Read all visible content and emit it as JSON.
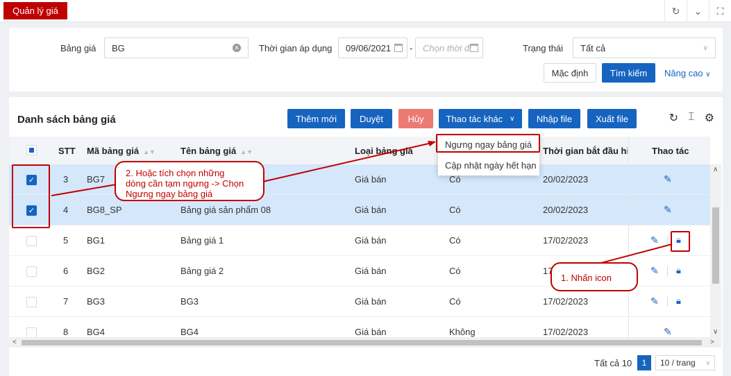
{
  "topbar": {
    "tab_label": "Quản lý giá"
  },
  "filter": {
    "price_list_label": "Bảng giá",
    "price_list_value": "BG",
    "apply_time_label": "Thời gian áp dụng",
    "date_from_value": "09/06/2021",
    "date_separator": "-",
    "date_to_placeholder": "Chọn thời đi",
    "status_label": "Trạng thái",
    "status_value": "Tất cả",
    "default_button": "Mặc định",
    "search_button": "Tìm kiếm",
    "advanced_link": "Nâng cao"
  },
  "list": {
    "title": "Danh sách bảng giá",
    "buttons": {
      "add": "Thêm mới",
      "approve": "Duyệt",
      "cancel": "Hủy",
      "more": "Thao tác khác",
      "import": "Nhập file",
      "export": "Xuất file"
    },
    "columns": {
      "stt": "STT",
      "code": "Mã bảng giá",
      "name": "Tên bảng giá",
      "type": "Loại bảng giá",
      "start": "Thời gian bắt đầu hiệu",
      "actions": "Thao tác"
    },
    "rows": [
      {
        "stt": "3",
        "code": "BG7",
        "name": "",
        "type": "Giá bán",
        "flag": "Có",
        "start": "20/02/2023",
        "checked": true,
        "lock": false
      },
      {
        "stt": "4",
        "code": "BG8_SP",
        "name": "Bảng giá sản phẩm 08",
        "type": "Giá bán",
        "flag": "Có",
        "start": "20/02/2023",
        "checked": true,
        "lock": false
      },
      {
        "stt": "5",
        "code": "BG1",
        "name": "Bảng giá 1",
        "type": "Giá bán",
        "flag": "Có",
        "start": "17/02/2023",
        "checked": false,
        "lock": true
      },
      {
        "stt": "6",
        "code": "BG2",
        "name": "Bảng giá 2",
        "type": "Giá bán",
        "flag": "Có",
        "start": "17",
        "checked": false,
        "lock": true
      },
      {
        "stt": "7",
        "code": "BG3",
        "name": "BG3",
        "type": "Giá bán",
        "flag": "Có",
        "start": "17/02/2023",
        "checked": false,
        "lock": true
      },
      {
        "stt": "8",
        "code": "BG4",
        "name": "BG4",
        "type": "Giá bán",
        "flag": "Không",
        "start": "17/02/2023",
        "checked": false,
        "lock": false
      }
    ]
  },
  "menu": {
    "item1": "Ngưng ngay bảng giá",
    "item2": "Cập nhật ngày hết hạn"
  },
  "pagination": {
    "total": "Tất cả 10",
    "current": "1",
    "page_size": "10 / trang"
  },
  "annotations": {
    "step1": "1. Nhấn icon",
    "step2_line1": "2. Hoặc tích chọn những",
    "step2_line2": "dòng cần tạm ngưng -> Chọn",
    "step2_line3": "Ngưng ngay bảng giá"
  },
  "colors": {
    "primary": "#1664c0",
    "danger": "#c00000",
    "selected_row": "#d5e7fb"
  }
}
